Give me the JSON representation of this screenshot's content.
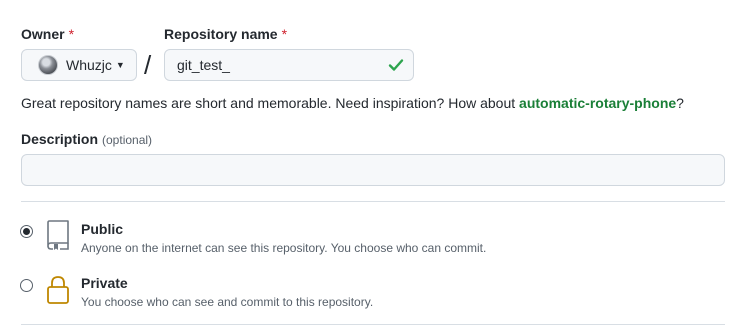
{
  "owner": {
    "label": "Owner",
    "required_mark": "*",
    "selected": "Whuzjc",
    "caret_icon": "triangle-down-icon"
  },
  "separator": "/",
  "repository": {
    "label": "Repository name",
    "required_mark": "*",
    "value": "git_test_",
    "status_icon": "check-icon",
    "status_color": "#2da44e"
  },
  "hint": {
    "prefix": "Great repository names are short and memorable. Need inspiration? How about ",
    "suggestion": "automatic-rotary-phone",
    "suffix": "?",
    "suggestion_color": "#1a7f37"
  },
  "description": {
    "label": "Description",
    "optional": "(optional)",
    "value": ""
  },
  "visibility": {
    "selected": "public",
    "options": [
      {
        "key": "public",
        "title": "Public",
        "description": "Anyone on the internet can see this repository. You choose who can commit.",
        "icon": "repo-icon"
      },
      {
        "key": "private",
        "title": "Private",
        "description": "You choose who can see and commit to this repository.",
        "icon": "lock-icon"
      }
    ]
  }
}
